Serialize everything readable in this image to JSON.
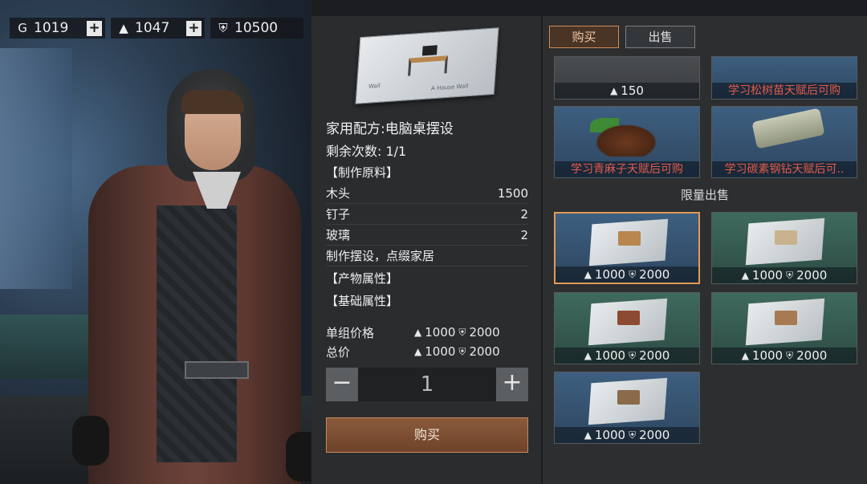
{
  "currencies": [
    {
      "icon": "G",
      "value": "1019",
      "plus": "+"
    },
    {
      "icon": "▲",
      "value": "1047",
      "plus": "+"
    },
    {
      "icon": "⛨",
      "value": "10500"
    }
  ],
  "detail": {
    "blueprint_caption_1": "Wall",
    "blueprint_caption_2": "A House Wall",
    "title": "家用配方:电脑桌摆设",
    "remaining": "剩余次数: 1/1",
    "materials_header": "【制作原料】",
    "materials": [
      {
        "name": "木头",
        "qty": "1500"
      },
      {
        "name": "钉子",
        "qty": "2"
      },
      {
        "name": "玻璃",
        "qty": "2"
      }
    ],
    "description": "制作摆设，点缀家居",
    "product_header": "【产物属性】",
    "base_header": "【基础属性】",
    "unit_price_label": "单组价格",
    "total_price_label": "总价",
    "unit_price": {
      "silver": "1000",
      "badge": "2000"
    },
    "total_price": {
      "silver": "1000",
      "badge": "2000"
    },
    "quantity": "1",
    "minus": "−",
    "plus": "+",
    "buy_label": "购买"
  },
  "shop": {
    "tabs": [
      {
        "label": "购买",
        "active": true
      },
      {
        "label": "出售",
        "active": false
      }
    ],
    "top_cards": [
      {
        "kind": "price",
        "silver": "150"
      },
      {
        "kind": "locked",
        "text": "学习松树苗天赋后可购"
      },
      {
        "kind": "locked",
        "text": "学习青麻子天赋后可购"
      },
      {
        "kind": "locked",
        "text": "学习碳素钢钻天赋后可.."
      }
    ],
    "limited_label": "限量出售",
    "limited_cards": [
      {
        "silver": "1000",
        "badge": "2000",
        "selected": true,
        "color": "blue",
        "item_color": "#b8864e"
      },
      {
        "silver": "1000",
        "badge": "2000",
        "selected": false,
        "color": "green",
        "item_color": "#c9b38e"
      },
      {
        "silver": "1000",
        "badge": "2000",
        "selected": false,
        "color": "green",
        "item_color": "#8d4a32"
      },
      {
        "silver": "1000",
        "badge": "2000",
        "selected": false,
        "color": "green",
        "item_color": "#a87a52"
      },
      {
        "silver": "1000",
        "badge": "2000",
        "selected": false,
        "color": "blue",
        "item_color": "#8a6a48"
      }
    ]
  }
}
